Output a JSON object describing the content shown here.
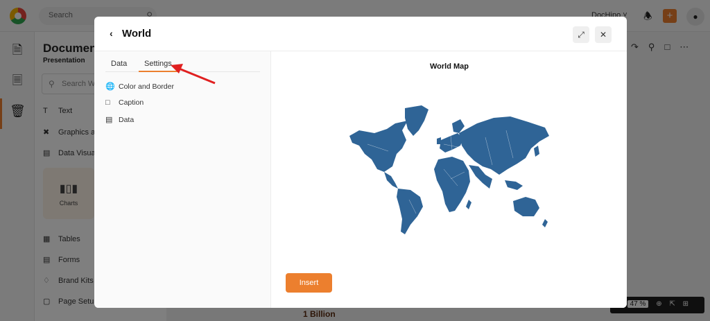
{
  "app": {
    "search_placeholder": "Search",
    "doc_menu_label": "DocHipo",
    "panel_title": "Documen",
    "panel_subtitle": "Presentation",
    "panel_search_placeholder": "Search Wi",
    "panel_items": {
      "text": "Text",
      "graphics": "Graphics ar",
      "data_visual": "Data Visual",
      "charts": "Charts",
      "tables": "Tables",
      "forms": "Forms",
      "brand_kits": "Brand Kits",
      "page_setup": "Page Setup"
    },
    "canvas_text": "1 Billion",
    "zoom_value": "47",
    "zoom_unit": "%"
  },
  "modal": {
    "title": "World",
    "tabs": [
      {
        "label": "Data",
        "active": false
      },
      {
        "label": "Settings",
        "active": true
      }
    ],
    "options": [
      {
        "label": "Color and Border",
        "icon": "globe-icon"
      },
      {
        "label": "Caption",
        "icon": "caption-icon"
      },
      {
        "label": "Data",
        "icon": "table-icon"
      }
    ],
    "map_title": "World Map",
    "map_color": "#2f6496",
    "insert_label": "Insert",
    "accent": "#ec7f2e"
  }
}
